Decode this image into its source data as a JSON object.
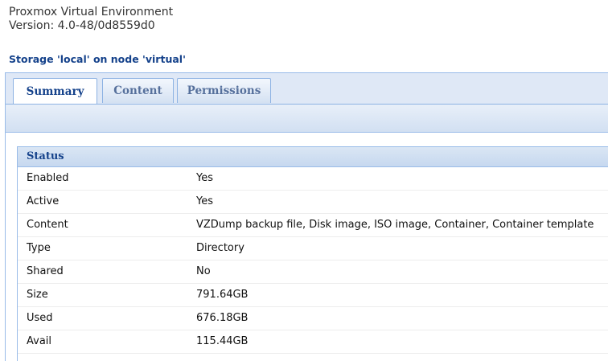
{
  "app": {
    "name": "Proxmox Virtual Environment",
    "version": "Version: 4.0-48/0d8559d0"
  },
  "storage_title": "Storage 'local' on node 'virtual'",
  "tabs": [
    {
      "label": "Summary",
      "active": true
    },
    {
      "label": "Content",
      "active": false
    },
    {
      "label": "Permissions",
      "active": false
    }
  ],
  "status": {
    "title": "Status",
    "rows": [
      {
        "key": "Enabled",
        "value": "Yes"
      },
      {
        "key": "Active",
        "value": "Yes"
      },
      {
        "key": "Content",
        "value": "VZDump backup file, Disk image, ISO image, Container, Container template"
      },
      {
        "key": "Type",
        "value": "Directory"
      },
      {
        "key": "Shared",
        "value": "No"
      },
      {
        "key": "Size",
        "value": "791.64GB"
      },
      {
        "key": "Used",
        "value": "676.18GB"
      },
      {
        "key": "Avail",
        "value": "115.44GB"
      }
    ]
  },
  "colors": {
    "accent": "#15428b",
    "border": "#99bbe8",
    "tabbar_bg": "#dfe8f6"
  }
}
